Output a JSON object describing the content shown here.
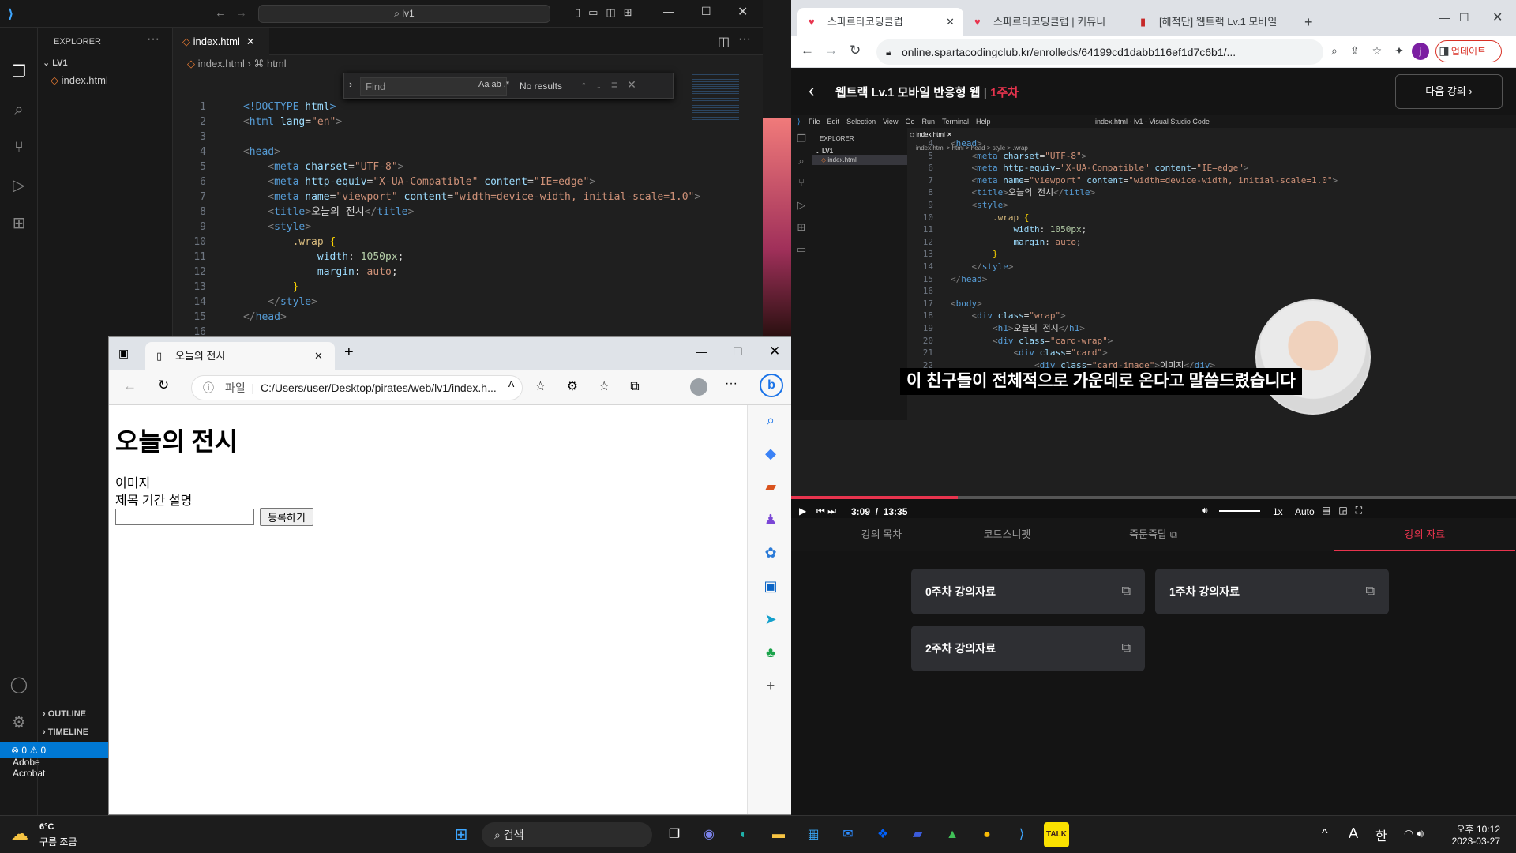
{
  "vscode": {
    "command_center": "lv1",
    "explorer_title": "EXPLORER",
    "folder": "LV1",
    "file": "index.html",
    "tab_label": "index.html",
    "breadcrumb_file": "index.html",
    "breadcrumb_node": "html",
    "find_placeholder": "Find",
    "find_options": "Aa  ab  .*",
    "find_result": "No results",
    "outline": "OUTLINE",
    "timeline": "TIMELINE",
    "status_problems": "⊗ 0 ⚠ 0",
    "code": [
      {
        "n": "1",
        "html": "<span class='t'>&lt;!DOCTYPE</span> <span class='a'>html</span><span class='t'>&gt;</span>"
      },
      {
        "n": "2",
        "html": "<span class='p'>&lt;</span><span class='t'>html</span> <span class='a'>lang</span>=<span class='s'>\"en\"</span><span class='p'>&gt;</span>"
      },
      {
        "n": "3",
        "html": ""
      },
      {
        "n": "4",
        "html": "<span class='p'>&lt;</span><span class='t'>head</span><span class='p'>&gt;</span>"
      },
      {
        "n": "5",
        "html": "    <span class='p'>&lt;</span><span class='t'>meta</span> <span class='a'>charset</span>=<span class='s'>\"UTF-8\"</span><span class='p'>&gt;</span>"
      },
      {
        "n": "6",
        "html": "    <span class='p'>&lt;</span><span class='t'>meta</span> <span class='a'>http-equiv</span>=<span class='s'>\"X-UA-Compatible\"</span> <span class='a'>content</span>=<span class='s'>\"IE=edge\"</span><span class='p'>&gt;</span>"
      },
      {
        "n": "7",
        "html": "    <span class='p'>&lt;</span><span class='t'>meta</span> <span class='a'>name</span>=<span class='s'>\"viewport\"</span> <span class='a'>content</span>=<span class='s'>\"width=device-width, initial-scale=1.0\"</span><span class='p'>&gt;</span>"
      },
      {
        "n": "8",
        "html": "    <span class='p'>&lt;</span><span class='t'>title</span><span class='p'>&gt;</span>오늘의 전시<span class='p'>&lt;/</span><span class='t'>title</span><span class='p'>&gt;</span>"
      },
      {
        "n": "9",
        "html": "    <span class='p'>&lt;</span><span class='t'>style</span><span class='p'>&gt;</span>"
      },
      {
        "n": "10",
        "html": "        <span class='c'>.wrap</span> <span class='y'>{</span>"
      },
      {
        "n": "11",
        "html": "            <span class='a'>width</span>: <span class='n'>1050px</span>;"
      },
      {
        "n": "12",
        "html": "            <span class='a'>margin</span>: <span class='s'>auto</span>;"
      },
      {
        "n": "13",
        "html": "        <span class='y'>}</span>"
      },
      {
        "n": "14",
        "html": "    <span class='p'>&lt;/</span><span class='t'>style</span><span class='p'>&gt;</span>"
      },
      {
        "n": "15",
        "html": "<span class='p'>&lt;/</span><span class='t'>head</span><span class='p'>&gt;</span>"
      },
      {
        "n": "16",
        "html": ""
      }
    ]
  },
  "edge": {
    "tab_title": "오늘의 전시",
    "info_label": "파일",
    "address": "C:/Users/user/Desktop/pirates/web/lv1/index.h...",
    "page": {
      "h1": "오늘의 전시",
      "line1": "이미지",
      "line2": "제목 기간 설명",
      "input_value": "",
      "button": "등록하기"
    }
  },
  "chrome": {
    "tabs": [
      "스파르타코딩클럽",
      "스파르타코딩클럽 | 커뮤니",
      "[해적단] 웹트랙 Lv.1 모바일"
    ],
    "url": "online.spartacodingclub.kr/enrolleds/64199cd1dabb116ef1d7c6b1/...",
    "update_label": "업데이트",
    "profile_initial": "j",
    "lecture_title": "웹트랙 Lv.1 모바일 반응형 웹",
    "lecture_week": "1주차",
    "next_label": "다음 강의",
    "subtitle": "이 친구들이 전체적으로 가운데로 온다고 말씀드렸습니다",
    "time_current": "3:09",
    "time_total": "13:35",
    "speed": "1x",
    "quality": "Auto",
    "inner_menu": [
      "File",
      "Edit",
      "Selection",
      "View",
      "Go",
      "Run",
      "Terminal",
      "Help"
    ],
    "inner_title": "index.html - lv1 - Visual Studio Code",
    "inner_explorer": "EXPLORER",
    "inner_folder": "LV1",
    "inner_file": "index.html",
    "inner_crumbs": "index.html > html > head > style > .wrap",
    "inner_code": [
      {
        "n": "4",
        "html": "<span class='p'>&lt;</span><span class='t'>head</span><span class='p'>&gt;</span>"
      },
      {
        "n": "5",
        "html": "    <span class='p'>&lt;</span><span class='t'>meta</span> <span class='a'>charset</span>=<span class='s'>\"UTF-8\"</span><span class='p'>&gt;</span>"
      },
      {
        "n": "6",
        "html": "    <span class='p'>&lt;</span><span class='t'>meta</span> <span class='a'>http-equiv</span>=<span class='s'>\"X-UA-Compatible\"</span> <span class='a'>content</span>=<span class='s'>\"IE=edge\"</span><span class='p'>&gt;</span>"
      },
      {
        "n": "7",
        "html": "    <span class='p'>&lt;</span><span class='t'>meta</span> <span class='a'>name</span>=<span class='s'>\"viewport\"</span> <span class='a'>content</span>=<span class='s'>\"width=device-width, initial-scale=1.0\"</span><span class='p'>&gt;</span>"
      },
      {
        "n": "8",
        "html": "    <span class='p'>&lt;</span><span class='t'>title</span><span class='p'>&gt;</span>오늘의 전시<span class='p'>&lt;/</span><span class='t'>title</span><span class='p'>&gt;</span>"
      },
      {
        "n": "9",
        "html": "    <span class='p'>&lt;</span><span class='t'>style</span><span class='p'>&gt;</span>"
      },
      {
        "n": "10",
        "html": "        <span class='c'>.wrap</span> <span class='y'>{</span>"
      },
      {
        "n": "11",
        "html": "            <span class='a'>width</span>: <span class='n'>1050px</span>;"
      },
      {
        "n": "12",
        "html": "            <span class='a'>margin</span>: <span class='s'>auto</span>;"
      },
      {
        "n": "13",
        "html": "        <span class='y'>}</span>"
      },
      {
        "n": "14",
        "html": "    <span class='p'>&lt;/</span><span class='t'>style</span><span class='p'>&gt;</span>"
      },
      {
        "n": "15",
        "html": "<span class='p'>&lt;/</span><span class='t'>head</span><span class='p'>&gt;</span>"
      },
      {
        "n": "16",
        "html": ""
      },
      {
        "n": "17",
        "html": "<span class='p'>&lt;</span><span class='t'>body</span><span class='p'>&gt;</span>"
      },
      {
        "n": "18",
        "html": "    <span class='p'>&lt;</span><span class='t'>div</span> <span class='a'>class</span>=<span class='s'>\"wrap\"</span><span class='p'>&gt;</span>"
      },
      {
        "n": "19",
        "html": "        <span class='p'>&lt;</span><span class='t'>h1</span><span class='p'>&gt;</span>오늘의 전시<span class='p'>&lt;/</span><span class='t'>h1</span><span class='p'>&gt;</span>"
      },
      {
        "n": "20",
        "html": "        <span class='p'>&lt;</span><span class='t'>div</span> <span class='a'>class</span>=<span class='s'>\"card-wrap\"</span><span class='p'>&gt;</span>"
      },
      {
        "n": "21",
        "html": "            <span class='p'>&lt;</span><span class='t'>div</span> <span class='a'>class</span>=<span class='s'>\"card\"</span><span class='p'>&gt;</span>"
      },
      {
        "n": "22",
        "html": "                <span class='p'>&lt;</span><span class='t'>div</span> <span class='a'>class</span>=<span class='s'>\"card-image\"</span><span class='p'>&gt;</span>이미지<span class='p'>&lt;/</span><span class='t'>div</span><span class='p'>&gt;</span>"
      }
    ],
    "lecture_tabs": [
      "강의 목차",
      "코드스니펫",
      "즉문즉답",
      "강의 자료"
    ],
    "materials": [
      "0주차 강의자료",
      "1주차 강의자료",
      "2주차 강의자료"
    ]
  },
  "taskbar": {
    "weather_temp": "6°C",
    "weather_desc": "구름 조금",
    "search": "검색",
    "ime_a": "A",
    "ime_han": "한",
    "time": "오후 10:12",
    "date": "2023-03-27",
    "tray_label": "Adobe\nAcrobat"
  },
  "accent_colors": {
    "vscode_blue": "#0078d4",
    "spartan_red": "#e8344e"
  }
}
